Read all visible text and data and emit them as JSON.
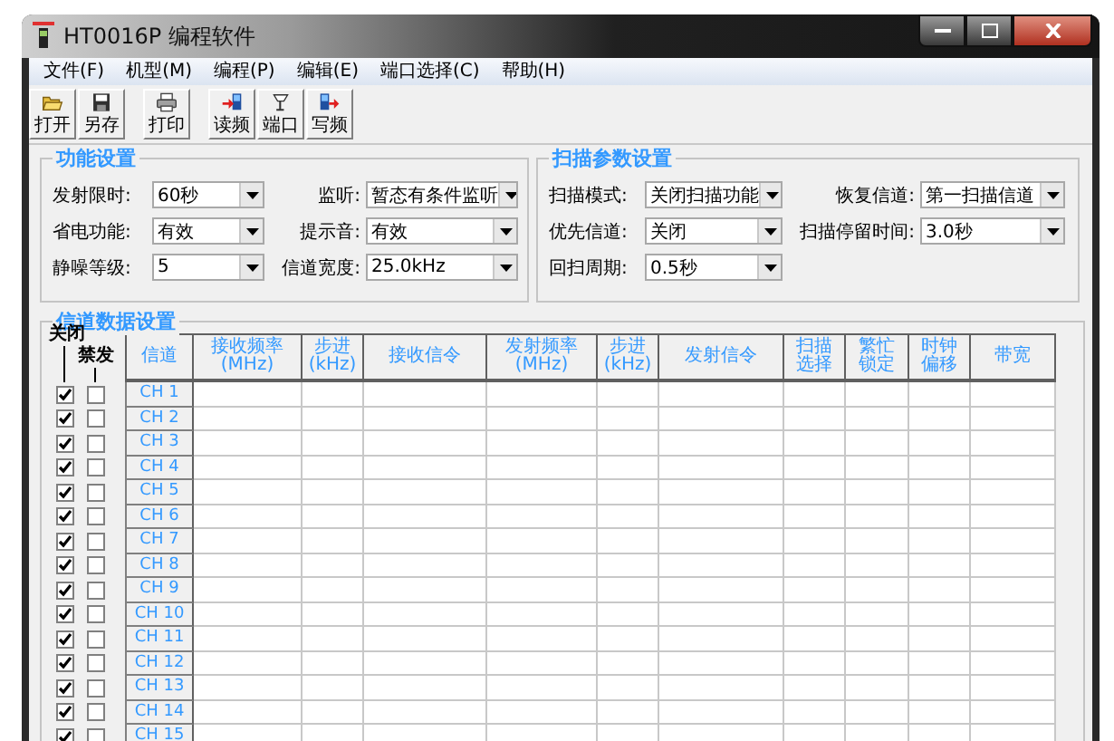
{
  "window": {
    "title": "HT0016P 编程软件"
  },
  "menu": [
    "文件(F)",
    "机型(M)",
    "编程(P)",
    "编辑(E)",
    "端口选择(C)",
    "帮助(H)"
  ],
  "toolbar": [
    [
      {
        "label": "打开",
        "kind": "open"
      },
      {
        "label": "另存",
        "kind": "save"
      }
    ],
    [
      {
        "label": "打印",
        "kind": "print"
      }
    ],
    [
      {
        "label": "读频",
        "kind": "read"
      },
      {
        "label": "端口",
        "kind": "port"
      },
      {
        "label": "写频",
        "kind": "write"
      }
    ]
  ],
  "function_settings": {
    "title": "功能设置",
    "fields": [
      {
        "label": "发射限时:",
        "value": "60秒"
      },
      {
        "label": "监听:",
        "value": "暂态有条件监听"
      },
      {
        "label": "省电功能:",
        "value": "有效"
      },
      {
        "label": "提示音:",
        "value": "有效"
      },
      {
        "label": "静噪等级:",
        "value": "5"
      },
      {
        "label": "信道宽度:",
        "value": "25.0kHz"
      }
    ]
  },
  "scan_settings": {
    "title": "扫描参数设置",
    "fields": [
      {
        "label": "扫描模式:",
        "value": "关闭扫描功能"
      },
      {
        "label": "恢复信道:",
        "value": "第一扫描信道"
      },
      {
        "label": "优先信道:",
        "value": "关闭"
      },
      {
        "label": "扫描停留时间:",
        "value": "3.0秒"
      },
      {
        "label": "回扫周期:",
        "value": "0.5秒"
      }
    ]
  },
  "channel_table": {
    "title": "信道数据设置",
    "check_headers": [
      "关闭",
      "禁发"
    ],
    "columns": [
      {
        "lines": [
          "信道"
        ]
      },
      {
        "lines": [
          "接收频率",
          "(MHz)"
        ]
      },
      {
        "lines": [
          "步进",
          "(kHz)"
        ]
      },
      {
        "lines": [
          "接收信令"
        ]
      },
      {
        "lines": [
          "发射频率",
          "(MHz)"
        ]
      },
      {
        "lines": [
          "步进",
          "(kHz)"
        ]
      },
      {
        "lines": [
          "发射信令"
        ]
      },
      {
        "lines": [
          "扫描",
          "选择"
        ]
      },
      {
        "lines": [
          "繁忙",
          "锁定"
        ]
      },
      {
        "lines": [
          "时钟",
          "偏移"
        ]
      },
      {
        "lines": [
          "带宽"
        ]
      }
    ],
    "rows": [
      {
        "channel": "CH 1",
        "closed": true,
        "tx_forbidden": false
      },
      {
        "channel": "CH 2",
        "closed": true,
        "tx_forbidden": false
      },
      {
        "channel": "CH 3",
        "closed": true,
        "tx_forbidden": false
      },
      {
        "channel": "CH 4",
        "closed": true,
        "tx_forbidden": false
      },
      {
        "channel": "CH 5",
        "closed": true,
        "tx_forbidden": false
      },
      {
        "channel": "CH 6",
        "closed": true,
        "tx_forbidden": false
      },
      {
        "channel": "CH 7",
        "closed": true,
        "tx_forbidden": false
      },
      {
        "channel": "CH 8",
        "closed": true,
        "tx_forbidden": false
      },
      {
        "channel": "CH 9",
        "closed": true,
        "tx_forbidden": false
      },
      {
        "channel": "CH 10",
        "closed": true,
        "tx_forbidden": false
      },
      {
        "channel": "CH 11",
        "closed": true,
        "tx_forbidden": false
      },
      {
        "channel": "CH 12",
        "closed": true,
        "tx_forbidden": false
      },
      {
        "channel": "CH 13",
        "closed": true,
        "tx_forbidden": false
      },
      {
        "channel": "CH 14",
        "closed": true,
        "tx_forbidden": false
      },
      {
        "channel": "CH 15",
        "closed": true,
        "tx_forbidden": false
      }
    ]
  }
}
